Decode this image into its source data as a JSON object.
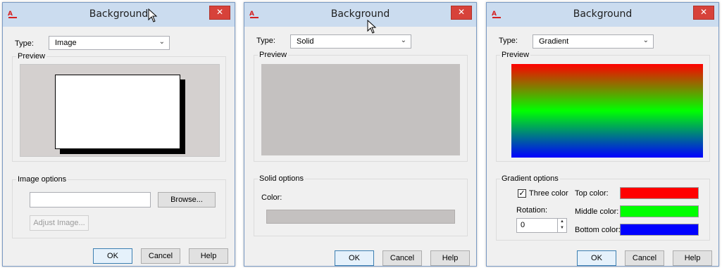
{
  "dialogs": [
    {
      "title": "Background",
      "app_icon": "A",
      "close": "✕",
      "type_label": "Type:",
      "type_value": "Image",
      "preview_label": "Preview",
      "options_label": "Image options",
      "browse_label": "Browse...",
      "adjust_label": "Adjust Image...",
      "ok": "OK",
      "cancel": "Cancel",
      "help": "Help"
    },
    {
      "title": "Background",
      "app_icon": "A",
      "close": "✕",
      "type_label": "Type:",
      "type_value": "Solid",
      "preview_label": "Preview",
      "options_label": "Solid options",
      "color_label": "Color:",
      "solid_color": "#c4c1c0",
      "ok": "OK",
      "cancel": "Cancel",
      "help": "Help"
    },
    {
      "title": "Background",
      "app_icon": "A",
      "close": "✕",
      "type_label": "Type:",
      "type_value": "Gradient",
      "preview_label": "Preview",
      "options_label": "Gradient options",
      "three_color_label": "Three color",
      "three_color_checked": true,
      "rotation_label": "Rotation:",
      "rotation_value": "0",
      "top_color_label": "Top color:",
      "middle_color_label": "Middle color:",
      "bottom_color_label": "Bottom color:",
      "top_color": "#ff0000",
      "middle_color": "#00ff00",
      "bottom_color": "#0000ff",
      "ok": "OK",
      "cancel": "Cancel",
      "help": "Help"
    }
  ],
  "icons": {
    "combo_arrow": "⌄",
    "checkmark": "✓",
    "spin_up": "▲",
    "spin_down": "▼",
    "cursor": "mouse-pointer-icon"
  }
}
